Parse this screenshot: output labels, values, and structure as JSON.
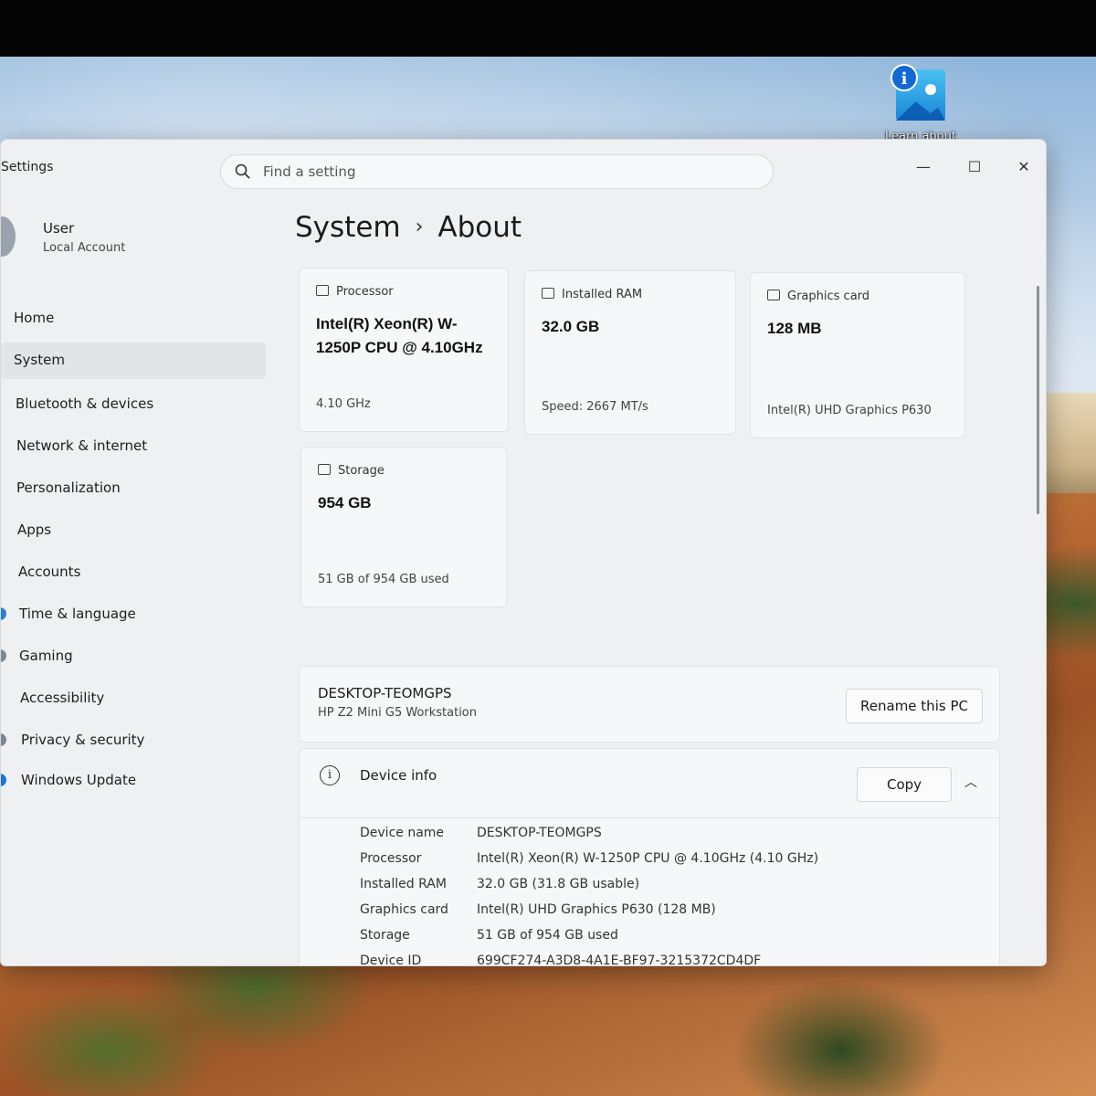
{
  "desktop": {
    "icon_label": "Learn about"
  },
  "window": {
    "app_title": "Settings",
    "search_placeholder": "Find a setting",
    "controls": {
      "minimize": "—",
      "maximize": "☐",
      "close": "✕"
    }
  },
  "user": {
    "name": "User",
    "account_type": "Local Account"
  },
  "nav": {
    "items": [
      {
        "label": "Home"
      },
      {
        "label": "System"
      },
      {
        "label": "Bluetooth & devices"
      },
      {
        "label": "Network & internet"
      },
      {
        "label": "Personalization"
      },
      {
        "label": "Apps"
      },
      {
        "label": "Accounts"
      },
      {
        "label": "Time & language"
      },
      {
        "label": "Gaming"
      },
      {
        "label": "Accessibility"
      },
      {
        "label": "Privacy & security"
      },
      {
        "label": "Windows Update"
      }
    ],
    "active": "System"
  },
  "breadcrumb": {
    "parent": "System",
    "separator": "›",
    "current": "About"
  },
  "cards": {
    "processor": {
      "title": "Processor",
      "value": "Intel(R) Xeon(R) W-1250P CPU @ 4.10GHz",
      "footer": "4.10 GHz"
    },
    "ram": {
      "title": "Installed RAM",
      "value": "32.0 GB",
      "footer": "Speed: 2667 MT/s"
    },
    "graphics": {
      "title": "Graphics card",
      "value": "128 MB",
      "footer": "Intel(R) UHD Graphics P630"
    },
    "storage": {
      "title": "Storage",
      "value": "954 GB",
      "footer": "51 GB of 954 GB used"
    }
  },
  "pc": {
    "name": "DESKTOP-TEOMGPS",
    "model": "HP Z2 Mini G5 Workstation",
    "rename_label": "Rename this PC"
  },
  "device_info": {
    "title": "Device info",
    "copy_label": "Copy",
    "chevron": "︿",
    "specs": [
      {
        "label": "Device name",
        "value": "DESKTOP-TEOMGPS"
      },
      {
        "label": "Processor",
        "value": "Intel(R) Xeon(R) W-1250P CPU @ 4.10GHz (4.10 GHz)"
      },
      {
        "label": "Installed RAM",
        "value": "32.0 GB (31.8 GB usable)"
      },
      {
        "label": "Graphics card",
        "value": "Intel(R) UHD Graphics P630 (128 MB)"
      },
      {
        "label": "Storage",
        "value": "51 GB of 954 GB used"
      },
      {
        "label": "Device ID",
        "value": "699CF274-A3D8-4A1E-BF97-3215372CD4DF"
      }
    ]
  },
  "colors": {
    "window_bg": "#eef0f2",
    "card_bg": "#f6f7f8",
    "nav_active": "#e2e5e8"
  }
}
